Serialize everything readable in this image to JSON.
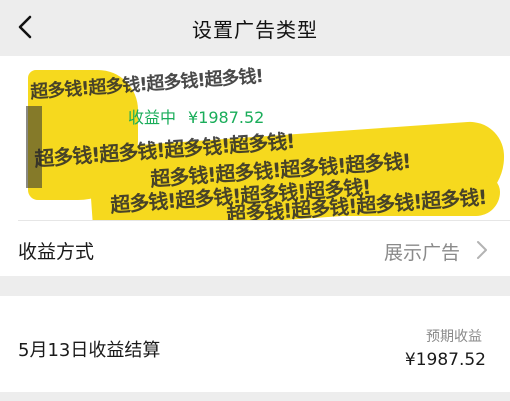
{
  "nav": {
    "title": "设置广告类型",
    "back_icon": "back-arrow-icon"
  },
  "banner": {
    "watermark_text": "超多钱!超多钱!超多钱!超多钱!",
    "status_label": "收益中",
    "status_amount": "¥1987.52",
    "colors": {
      "status": "#1aad5a",
      "highlight": "#f6d91e"
    }
  },
  "method": {
    "label": "收益方式",
    "value": "展示广告",
    "chevron_icon": "chevron-right-icon"
  },
  "settlement": {
    "date_label": "5月13日收益结算",
    "expected_label": "预期收益",
    "expected_amount": "¥1987.52"
  }
}
